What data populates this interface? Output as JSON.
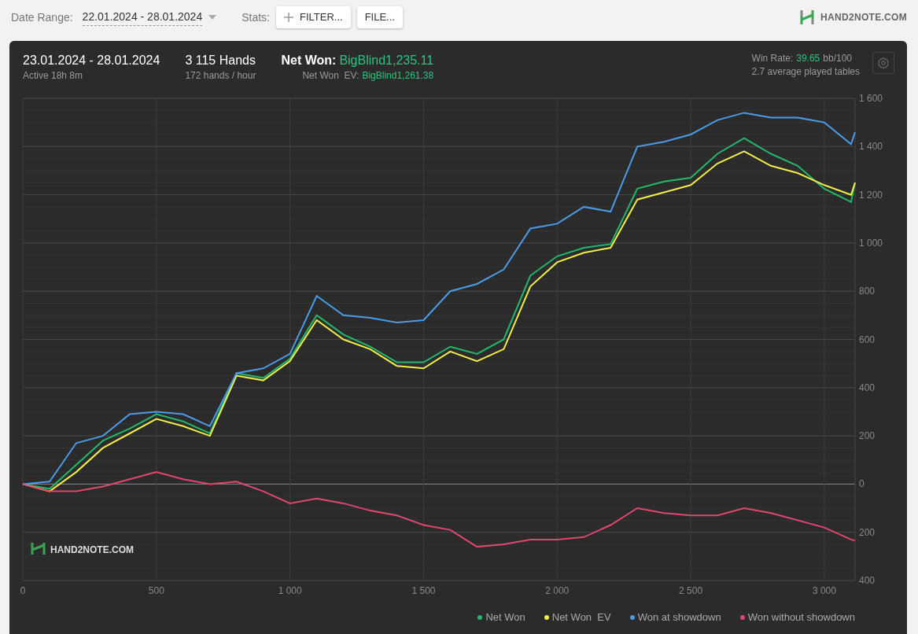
{
  "toolbar": {
    "date_range": {
      "label": "Date Range:",
      "value": "22.01.2024 - 28.01.2024"
    },
    "stats_label": "Stats:",
    "buttons": [
      {
        "label": "FILTER...",
        "kind": "add"
      },
      {
        "label": "FILE...",
        "kind": "plain"
      }
    ],
    "logo": "HAND2NOTE.COM"
  },
  "summary": {
    "period": "23.01.2024 - 28.01.2024",
    "active": "Active 18h 8m",
    "hands": "3 115 Hands",
    "hands_per_hour": "172 hands / hour",
    "net_won": {
      "label": "Net Won:",
      "value": "BigBlind1,235.11"
    },
    "net_won_ev": {
      "label": "Net Won  EV:",
      "value": "BigBlind1,261.38"
    },
    "win_rate": {
      "label": "Win Rate:",
      "value": "39.65",
      "unit": "bb/100"
    },
    "tables": "2.7 average played tables"
  },
  "chart": {
    "logo": "HAND2NOTE.COM",
    "chart_data": {
      "type": "line",
      "grid": true,
      "legend": "bottom-right",
      "x": [
        0,
        100,
        200,
        300,
        400,
        500,
        600,
        700,
        800,
        900,
        1000,
        1100,
        1200,
        1300,
        1400,
        1500,
        1600,
        1700,
        1800,
        1900,
        2000,
        2100,
        2200,
        2300,
        2400,
        2500,
        2600,
        2700,
        2800,
        2900,
        3000,
        3100,
        3115
      ],
      "xlim": [
        0,
        3115
      ],
      "ylim": [
        -400,
        1600
      ],
      "xticks": [
        {
          "value": 0,
          "label": "0"
        },
        {
          "value": 500,
          "label": "500"
        },
        {
          "value": 1000,
          "label": "1 000"
        },
        {
          "value": 1500,
          "label": "1 500"
        },
        {
          "value": 2000,
          "label": "2 000"
        },
        {
          "value": 2500,
          "label": "2 500"
        },
        {
          "value": 3000,
          "label": "3 000"
        }
      ],
      "yticks": [
        {
          "value": 1600,
          "label": "1 600"
        },
        {
          "value": 1400,
          "label": "1 400"
        },
        {
          "value": 1200,
          "label": "1 200"
        },
        {
          "value": 1000,
          "label": "1 000"
        },
        {
          "value": 800,
          "label": "800"
        },
        {
          "value": 600,
          "label": "600"
        },
        {
          "value": 400,
          "label": "400"
        },
        {
          "value": 200,
          "label": "200"
        },
        {
          "value": 0,
          "label": "0"
        },
        {
          "value": -200,
          "label": "200"
        },
        {
          "value": -400,
          "label": "400"
        }
      ],
      "series": [
        {
          "name": "Net Won",
          "color": "#22b86c",
          "values": [
            0,
            -20,
            80,
            180,
            230,
            290,
            260,
            210,
            460,
            440,
            520,
            700,
            620,
            570,
            505,
            505,
            570,
            540,
            600,
            865,
            945,
            980,
            995,
            1225,
            1255,
            1270,
            1370,
            1435,
            1370,
            1320,
            1225,
            1170,
            1250
          ]
        },
        {
          "name": "Net Won  EV",
          "color": "#f2ee4a",
          "values": [
            0,
            -30,
            50,
            150,
            210,
            270,
            240,
            200,
            450,
            430,
            510,
            680,
            600,
            560,
            490,
            480,
            550,
            510,
            560,
            820,
            920,
            960,
            980,
            1180,
            1210,
            1240,
            1330,
            1380,
            1320,
            1290,
            1240,
            1200,
            1250
          ]
        },
        {
          "name": "Won at showdown",
          "color": "#4a9be8",
          "values": [
            0,
            10,
            170,
            200,
            290,
            300,
            290,
            240,
            460,
            480,
            540,
            780,
            700,
            690,
            670,
            680,
            800,
            830,
            890,
            1060,
            1080,
            1150,
            1130,
            1400,
            1420,
            1450,
            1510,
            1540,
            1520,
            1520,
            1500,
            1410,
            1460
          ]
        },
        {
          "name": "Won without showdown",
          "color": "#e0466e",
          "values": [
            0,
            -30,
            -30,
            -10,
            20,
            50,
            20,
            0,
            10,
            -30,
            -80,
            -60,
            -80,
            -110,
            -130,
            -170,
            -190,
            -260,
            -250,
            -230,
            -230,
            -220,
            -170,
            -100,
            -120,
            -130,
            -130,
            -100,
            -120,
            -150,
            -180,
            -230,
            -235
          ]
        }
      ]
    }
  }
}
